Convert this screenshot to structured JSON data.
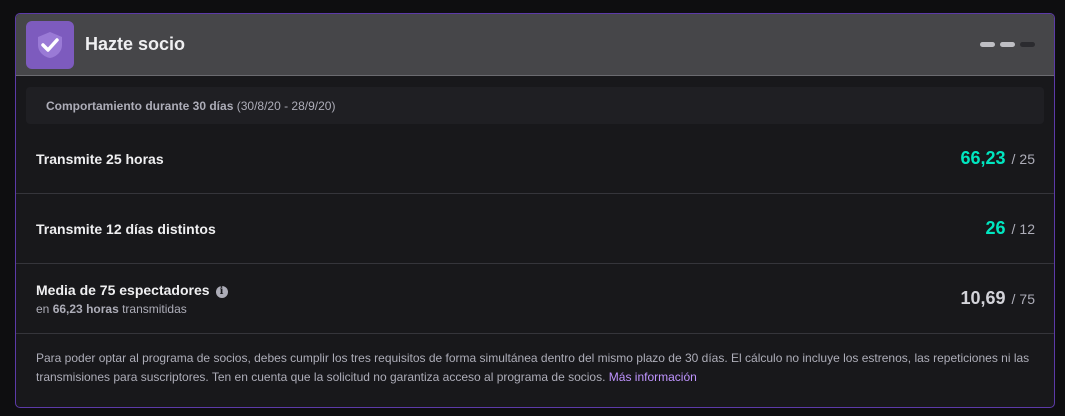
{
  "header": {
    "title": "Hazte socio",
    "badge_icon": "check-shield-icon",
    "accent_color": "#7d5bbe",
    "progress_steps_total": 3,
    "progress_steps_done": 2
  },
  "period": {
    "label": "Comportamiento durante 30 días",
    "range": "(30/8/20 - 28/9/20)"
  },
  "requirements": [
    {
      "label": "Transmite 25 horas",
      "value": "66,23",
      "target": "25",
      "met": true
    },
    {
      "label": "Transmite 12 días distintos",
      "value": "26",
      "target": "12",
      "met": true
    },
    {
      "label": "Media de 75 espectadores",
      "sub_prefix": "en",
      "sub_hours": "66,23 horas",
      "sub_suffix": "transmitidas",
      "value": "10,69",
      "target": "75",
      "met": false,
      "info_icon": "info-icon"
    }
  ],
  "separator": "/",
  "footnote": {
    "text": "Para poder optar al programa de socios, debes cumplir los tres requisitos de forma simultánea dentro del mismo plazo de 30 días. El cálculo no incluye los estrenos, las repeticiones ni las transmisiones para suscriptores. Ten en cuenta que la solicitud no garantiza acceso al programa de socios.",
    "link": "Más información"
  },
  "colors": {
    "met": "#00e6c0",
    "not_met": "#d3d3d9",
    "link": "#bf94ff"
  }
}
